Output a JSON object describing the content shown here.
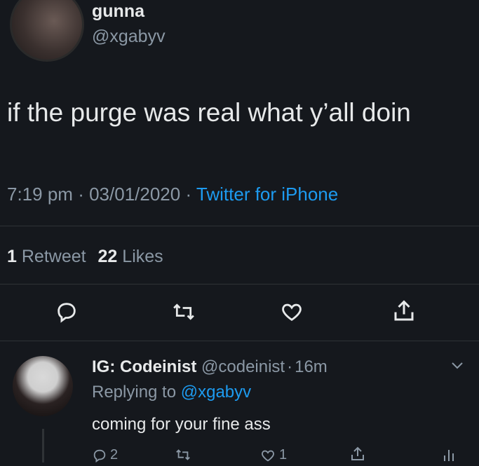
{
  "tweet": {
    "display_name": "gunna",
    "handle": "@xgabyv",
    "text": "if the purge was real what y’all doin",
    "time": "7:19 pm",
    "date": "03/01/2020",
    "separator": "·",
    "source": "Twitter for iPhone",
    "retweet_count": "1",
    "retweet_label": "Retweet",
    "like_count": "22",
    "like_label": "Likes"
  },
  "reply": {
    "display_name": "IG: Codeinist",
    "handle": "@codeinist",
    "separator": "·",
    "age": "16m",
    "replying_prefix": "Replying to",
    "replying_handle": "@xgabyv",
    "text": "coming for your fine ass",
    "reply_count": "2",
    "like_count": "1"
  },
  "colors": {
    "background": "#15181d",
    "text": "#e7e9ea",
    "muted": "#8b98a5",
    "link": "#1d9bf0",
    "divider": "#2f3336"
  },
  "icons": [
    "reply-icon",
    "retweet-icon",
    "like-icon",
    "share-icon",
    "chevron-down-icon",
    "analytics-icon"
  ]
}
